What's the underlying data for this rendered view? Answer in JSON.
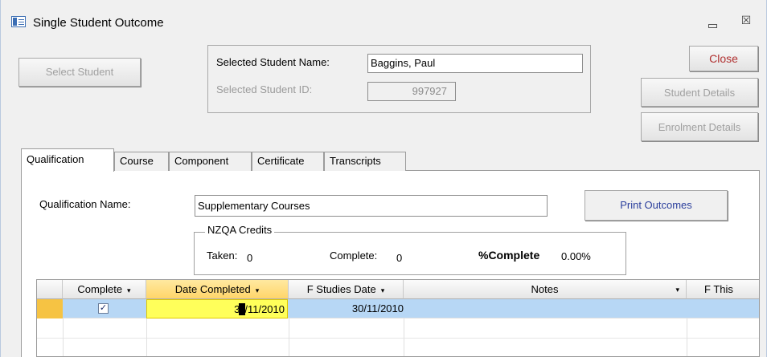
{
  "window": {
    "title": "Single Student Outcome",
    "minimize_symbol": "▭",
    "close_symbol": "☒"
  },
  "buttons": {
    "select_student": "Select Student",
    "close": "Close",
    "student_details": "Student Details",
    "enrolment_details": "Enrolment Details",
    "print_outcomes": "Print Outcomes"
  },
  "student": {
    "name_label": "Selected Student Name:",
    "name_value": "Baggins, Paul",
    "id_label": "Selected Student ID:",
    "id_value": "997927"
  },
  "tabs": [
    {
      "label": "Qualification"
    },
    {
      "label": "Course"
    },
    {
      "label": "Component"
    },
    {
      "label": "Certificate"
    },
    {
      "label": "Transcripts"
    }
  ],
  "qualification": {
    "name_label": "Qualification Name:",
    "name_value": "Supplementary Courses"
  },
  "credits": {
    "title": "NZQA Credits",
    "taken_label": "Taken:",
    "taken_value": "0",
    "complete_label": "Complete:",
    "complete_value": "0",
    "pct_label": "%Complete",
    "pct_value": "0.00%"
  },
  "grid": {
    "columns": [
      "Complete",
      "Date Completed",
      "F Studies Date",
      "Notes",
      "F This"
    ],
    "arrow": "▾",
    "rows": [
      {
        "complete": true,
        "check_glyph": "✓",
        "date_completed_before": "3",
        "date_completed_after": "/11/2010",
        "f_studies_date": "30/11/2010",
        "notes": ""
      }
    ]
  },
  "colors": {
    "selected_row": "#b7d7f5",
    "active_cell": "#ffff5a",
    "row_selector": "#f6c343",
    "link_button": "#2a3e9c",
    "close_button": "#b03030"
  }
}
